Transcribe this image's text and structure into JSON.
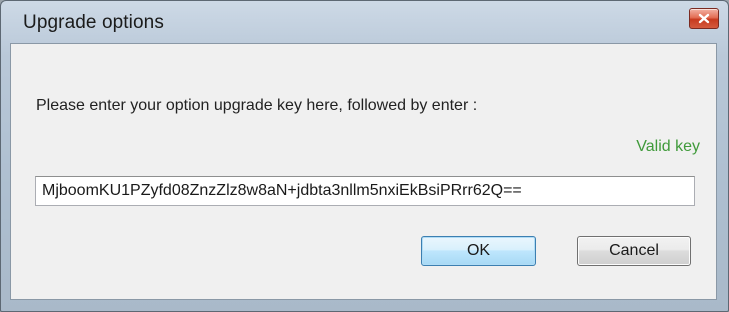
{
  "window": {
    "title": "Upgrade options",
    "close_icon": "close-icon"
  },
  "dialog": {
    "prompt": "Please enter your option upgrade key here, followed by enter :",
    "status": "Valid key",
    "key_value": "MjboomKU1PZyfd08ZnzZlz8w8aN+jdbta3nllm5nxiEkBsiPRrr62Q==",
    "ok_label": "OK",
    "cancel_label": "Cancel"
  },
  "colors": {
    "status_valid": "#3f9a3a",
    "close_button": "#d4543a",
    "ok_border": "#3c7fb1"
  }
}
